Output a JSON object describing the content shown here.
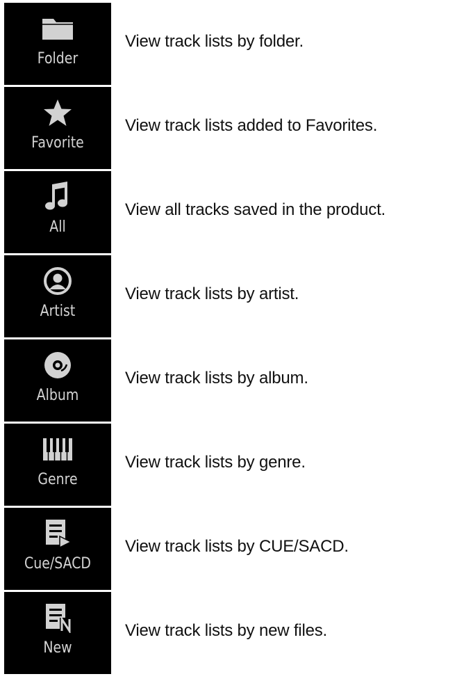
{
  "rows": [
    {
      "tile_label": "Folder",
      "icon": "folder-icon",
      "description": "View track lists by folder."
    },
    {
      "tile_label": "Favorite",
      "icon": "star-icon",
      "description": "View track lists added to Favorites."
    },
    {
      "tile_label": "All",
      "icon": "music-note-icon",
      "description": "View all tracks saved in the product."
    },
    {
      "tile_label": "Artist",
      "icon": "person-icon",
      "description": "View track lists by  artist."
    },
    {
      "tile_label": "Album",
      "icon": "disc-icon",
      "description": "View track lists by album."
    },
    {
      "tile_label": "Genre",
      "icon": "piano-keys-icon",
      "description": "View track lists by genre."
    },
    {
      "tile_label": "Cue/SACD",
      "icon": "list-play-icon",
      "description": "View track lists by CUE/SACD."
    },
    {
      "tile_label": "New",
      "icon": "list-new-icon",
      "description": "View track lists by new  files."
    }
  ],
  "colors": {
    "tile_background": "#000000",
    "tile_foreground": "#d2d2d2",
    "description_text": "#111111",
    "page_background": "#ffffff"
  }
}
